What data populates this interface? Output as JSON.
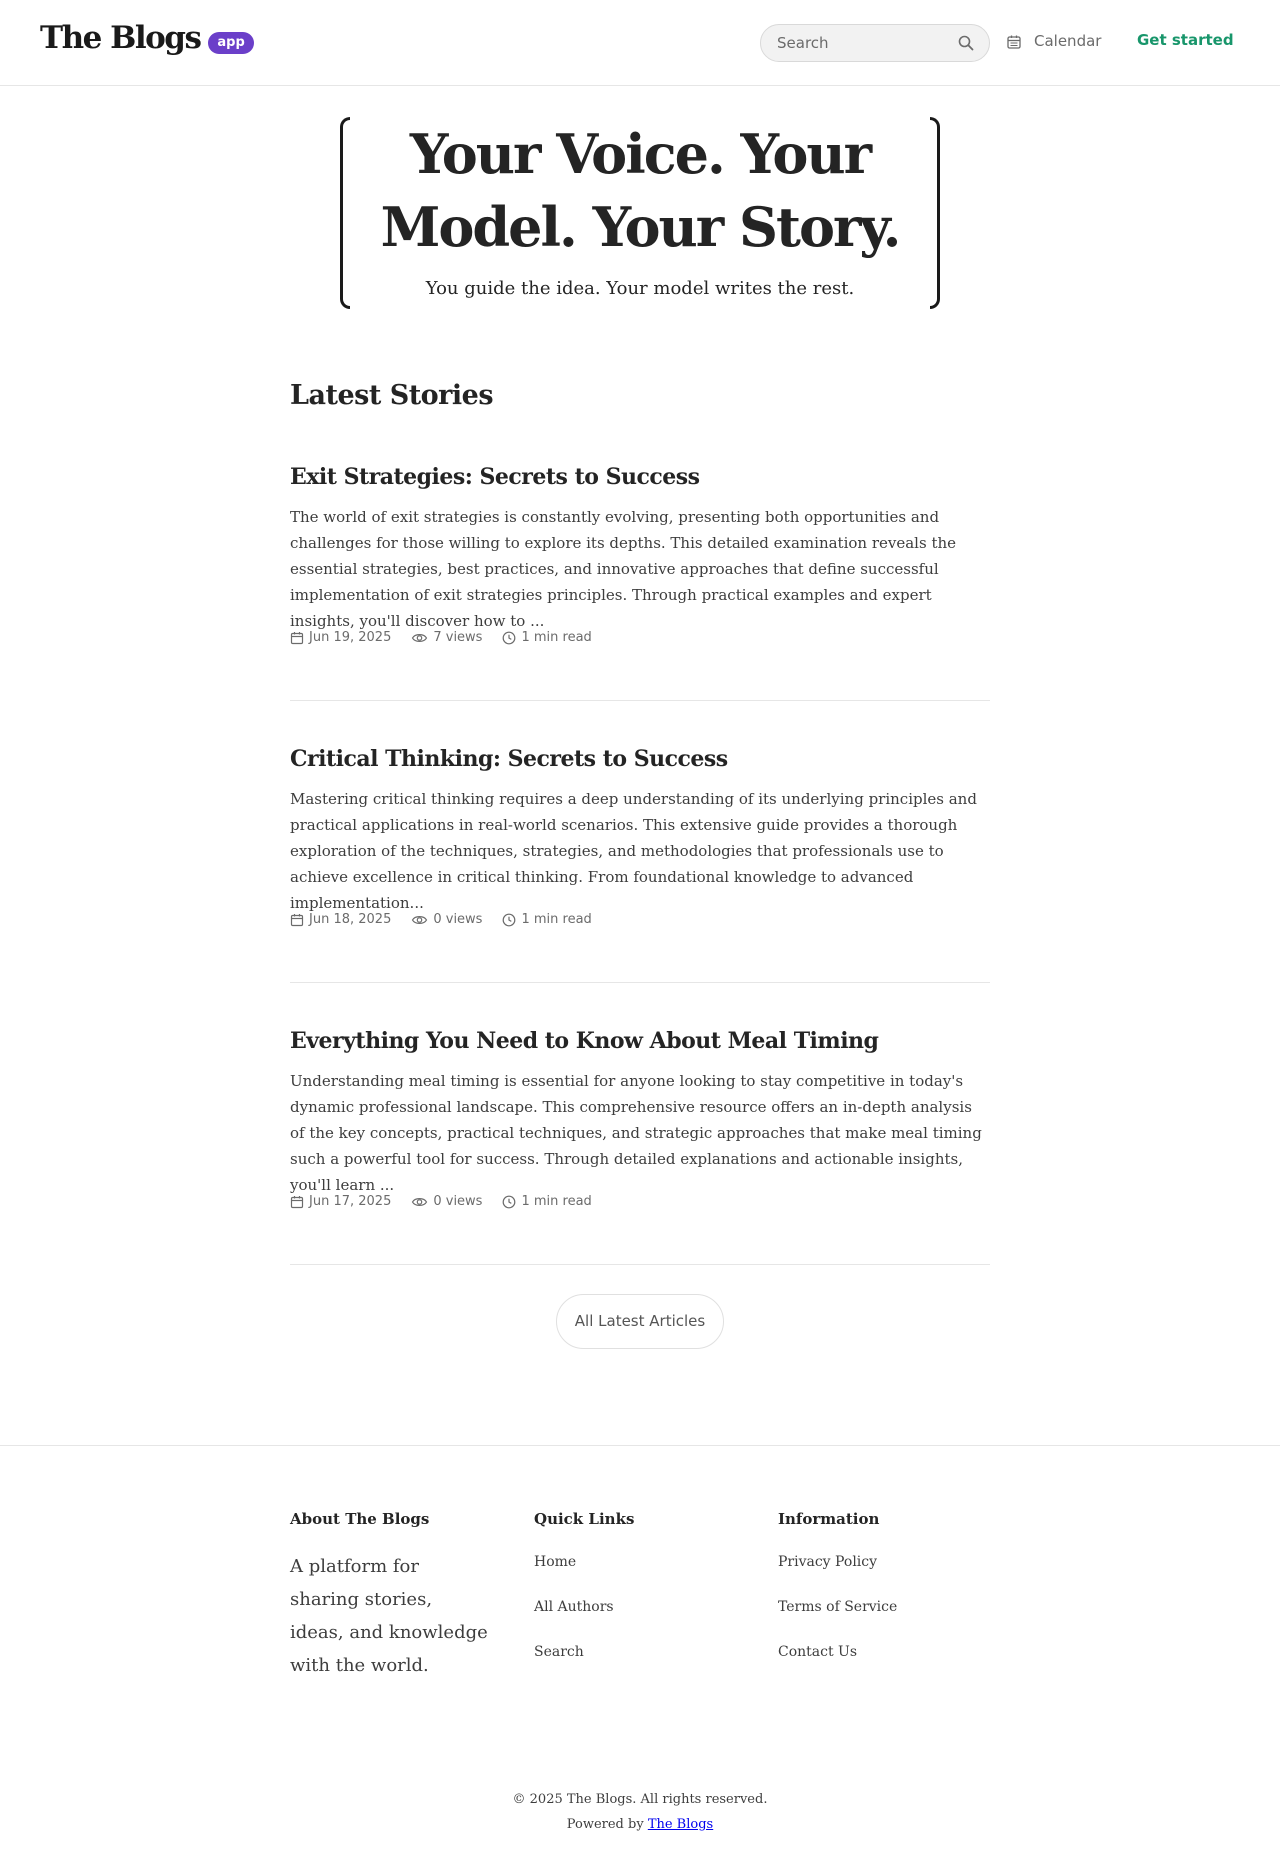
{
  "header": {
    "logo_text": "The Blogs",
    "logo_badge": "app",
    "search_placeholder": "Search",
    "calendar_label": "Calendar",
    "get_started_label": "Get started"
  },
  "hero": {
    "title": "Your Voice. Your Model. Your Story.",
    "subtitle": "You guide the idea. Your model writes the rest."
  },
  "main": {
    "section_title": "Latest Stories",
    "articles": [
      {
        "title": "Exit Strategies: Secrets to Success",
        "excerpt": "The world of exit strategies is constantly evolving, presenting both opportunities and challenges for those willing to explore its depths. This detailed examination reveals the essential strategies, best practices, and innovative approaches that define successful implementation of exit strategies principles. Through practical examples and expert insights, you'll discover how to ...",
        "date": "Jun 19, 2025",
        "views": "7 views",
        "read_time": "1 min read"
      },
      {
        "title": "Critical Thinking: Secrets to Success",
        "excerpt": "Mastering critical thinking requires a deep understanding of its underlying principles and practical applications in real-world scenarios. This extensive guide provides a thorough exploration of the techniques, strategies, and methodologies that professionals use to achieve excellence in critical thinking. From foundational knowledge to advanced implementation...",
        "date": "Jun 18, 2025",
        "views": "0 views",
        "read_time": "1 min read"
      },
      {
        "title": "Everything You Need to Know About Meal Timing",
        "excerpt": "Understanding meal timing is essential for anyone looking to stay competitive in today's dynamic professional landscape. This comprehensive resource offers an in-depth analysis of the key concepts, practical techniques, and strategic approaches that make meal timing such a powerful tool for success. Through detailed explanations and actionable insights, you'll learn ...",
        "date": "Jun 17, 2025",
        "views": "0 views",
        "read_time": "1 min read"
      }
    ],
    "all_articles_label": "All Latest Articles"
  },
  "footer": {
    "about": {
      "heading": "About The Blogs",
      "text": "A platform for sharing stories, ideas, and knowledge with the world."
    },
    "quick_links": {
      "heading": "Quick Links",
      "links": [
        "Home",
        "All Authors",
        "Search"
      ]
    },
    "information": {
      "heading": "Information",
      "links": [
        "Privacy Policy",
        "Terms of Service",
        "Contact Us"
      ]
    },
    "copyright": "© 2025 The Blogs. All rights reserved.",
    "powered_by": "Powered by",
    "powered_by_link": "The Blogs"
  },
  "colors": {
    "accent_green": "#18966b",
    "badge_purple": "#6b3fc9",
    "text_dark": "#242424"
  },
  "icons": {
    "search": "search-icon",
    "calendar": "calendar-icon",
    "views": "eye-icon",
    "read_time": "clock-icon"
  }
}
